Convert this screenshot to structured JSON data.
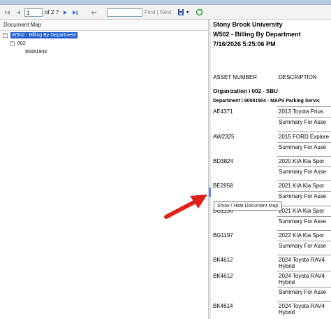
{
  "toolbar": {
    "page_value": "1",
    "page_total": "of 2 ?",
    "find_label": "Find",
    "next_label": "Next",
    "icons": [
      "first-page-icon",
      "previous-page-icon",
      "next-page-icon",
      "last-page-icon",
      "back-icon",
      "export-icon",
      "refresh-icon"
    ]
  },
  "doc_map": {
    "header": "Document Map",
    "tree": {
      "root": "W502 - Billing By Department",
      "child": "002",
      "grandchild": "90081904"
    }
  },
  "tooltip": "Show / Hide Document Map",
  "report": {
    "title_1": "Stony Brook University",
    "title_2": "W502 - Billing By Department",
    "title_3": "7/16/2026 5:25:06 PM",
    "col_asset": "ASSET NUMBER",
    "col_desc": "DESCRIPTION",
    "organization": "Organization \\ 002 - SBU",
    "department": "Department \\ 90081904 - MAPS Parking Servic",
    "rows": [
      {
        "asset": "AE4371",
        "desc": "2013 Toyota Prius",
        "summary": "Summary For Asse"
      },
      {
        "asset": "AW2325",
        "desc": "2015 FORD Explore",
        "summary": "Summary For Asse"
      },
      {
        "asset": "BD3824",
        "desc": "2020 KIA Kia Spor",
        "summary": "Summary For Asse"
      },
      {
        "asset": "BE2958",
        "desc": "2021 KIA Kia Spor",
        "summary": "Summary For Asse"
      },
      {
        "asset": "BG1196",
        "desc": "2021 KIA Kia Spor",
        "summary": "Summary For Asse"
      },
      {
        "asset": "BG1197",
        "desc": "2022 KIA Kia Spor",
        "summary": "Summary For Asse"
      },
      {
        "asset": "BK4612",
        "desc": "2024 Toyota RAV4",
        "desc2": "Hybrid"
      },
      {
        "asset": "BK4612",
        "desc": "2024 Toyota RAV4",
        "desc2": "Hybrid",
        "summary": "Summary For Asse"
      },
      {
        "asset": "BK4614",
        "desc": "2024 Toyota RAV4",
        "desc2": "Hybrid"
      }
    ]
  },
  "colors": {
    "selection": "#1f5fd0",
    "toolbar_blue": "#3a6fc4",
    "arrow": "#e0201b",
    "splitter_handle": "#5a8fd8"
  }
}
